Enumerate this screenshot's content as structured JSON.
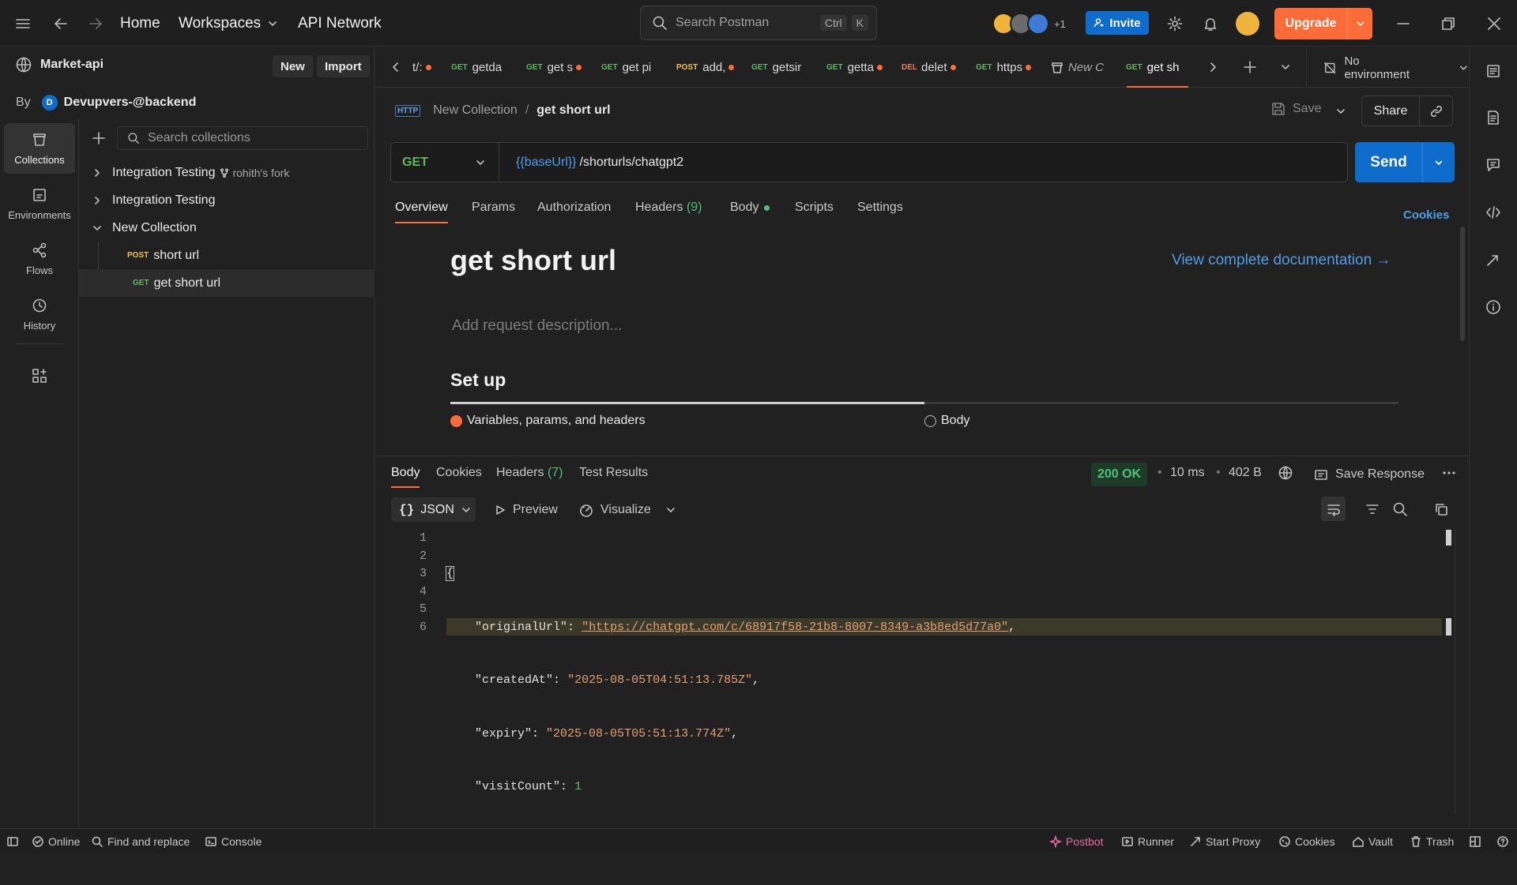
{
  "topbar": {
    "home": "Home",
    "workspaces": "Workspaces",
    "api_network": "API Network",
    "search_placeholder": "Search Postman",
    "search_shortcut_ctrl": "Ctrl",
    "search_shortcut_key": "K",
    "avatars_extra": "+1",
    "invite": "Invite",
    "upgrade": "Upgrade"
  },
  "workspace": {
    "name": "Market-api",
    "new": "New",
    "import": "Import",
    "by": "By",
    "owner_initial": "D",
    "owner": "Devupvers-@backend"
  },
  "rail": {
    "collections": "Collections",
    "environments": "Environments",
    "flows": "Flows",
    "history": "History"
  },
  "sidebar": {
    "search_placeholder": "Search collections",
    "items": [
      {
        "label": "Integration Testing",
        "fork": "rohith's fork"
      },
      {
        "label": "Integration Testing"
      },
      {
        "label": "New Collection"
      },
      {
        "method": "POST",
        "label": "short url"
      },
      {
        "method": "GET",
        "label": "get short url"
      }
    ]
  },
  "tabs": [
    {
      "method": "",
      "label": "t/:"
    },
    {
      "method": "GET",
      "label": "getda"
    },
    {
      "method": "GET",
      "label": "get s"
    },
    {
      "method": "GET",
      "label": "get pi"
    },
    {
      "method": "POST",
      "label": "add,"
    },
    {
      "method": "GET",
      "label": "getsir"
    },
    {
      "method": "GET",
      "label": "getta"
    },
    {
      "method": "DEL",
      "label": "delet"
    },
    {
      "method": "GET",
      "label": "https"
    },
    {
      "method": "",
      "label": "New C"
    },
    {
      "method": "GET",
      "label": "get sh"
    }
  ],
  "environment": "No environment",
  "request": {
    "breadcrumb_parent": "New Collection",
    "breadcrumb_sep": "/",
    "breadcrumb_current": "get short url",
    "save": "Save",
    "share": "Share",
    "method": "GET",
    "url_var": "{{baseUrl}}",
    "url_path": "/shorturls/chatgpt2",
    "send": "Send",
    "subtabs": [
      "Overview",
      "Params",
      "Authorization",
      "Headers",
      "Body",
      "Scripts",
      "Settings"
    ],
    "headers_count": "(9)",
    "cookies": "Cookies"
  },
  "overview": {
    "title": "get short url",
    "doc_link": "View complete documentation →",
    "description_placeholder": "Add request description...",
    "setup_title": "Set up",
    "step1": "Variables, params, and headers",
    "step2": "Body",
    "progress": 0.5
  },
  "response": {
    "tabs": [
      "Body",
      "Cookies",
      "Headers",
      "Test Results"
    ],
    "headers_count": "(7)",
    "status": "200 OK",
    "time": "10 ms",
    "size": "402 B",
    "save_response": "Save Response",
    "format": "JSON",
    "preview": "Preview",
    "visualize": "Visualize",
    "lines": [
      "1",
      "2",
      "3",
      "4",
      "5",
      "6"
    ],
    "body": {
      "open": "{",
      "k1": "\"originalUrl\"",
      "v1": "\"https://chatgpt.com/c/68917f58-21b8-8007-8349-a3b8ed5d77a0\"",
      "k2": "\"createdAt\"",
      "v2": "\"2025-08-05T04:51:13.785Z\"",
      "k3": "\"expiry\"",
      "v3": "\"2025-08-05T05:51:13.774Z\"",
      "k4": "\"visitCount\"",
      "v4": "1",
      "close": "}"
    }
  },
  "statusbar": {
    "online": "Online",
    "find_replace": "Find and replace",
    "console": "Console",
    "postbot": "Postbot",
    "runner": "Runner",
    "start_proxy": "Start Proxy",
    "cookies": "Cookies",
    "vault": "Vault",
    "trash": "Trash"
  },
  "colors": {
    "accent_orange": "#ff6c37",
    "accent_blue": "#0d6ccc",
    "get_green": "#5fb85f",
    "post_yellow": "#e8c357",
    "status_ok": "#4fc07a"
  }
}
